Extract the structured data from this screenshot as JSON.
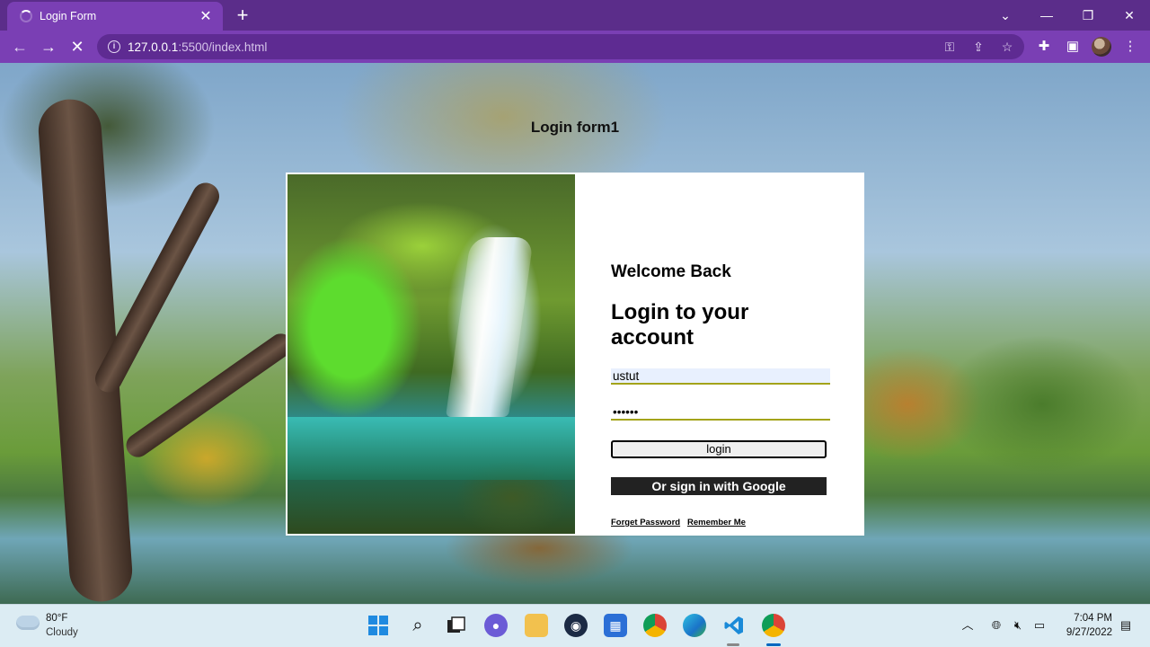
{
  "browser": {
    "tab_title": "Login Form",
    "tab_close": "✕",
    "new_tab": "+",
    "url_host": "127.0.0.1",
    "url_path": ":5500/index.html",
    "window_controls": {
      "tabsearch": "⌄",
      "minimize": "—",
      "restore": "❐",
      "close": "✕"
    },
    "icons": [
      "back-icon",
      "forward-icon",
      "stop-icon",
      "site-info-icon",
      "password-key-icon",
      "share-icon",
      "bookmark-star-icon",
      "extensions-icon",
      "side-panel-icon",
      "profile-avatar",
      "menu-icon"
    ]
  },
  "page": {
    "heading": "Login form1",
    "card": {
      "welcome": "Welcome Back",
      "title": "Login to your account",
      "username_value": "ustut",
      "password_value": "••••••",
      "login_label": "login",
      "google_label": "Or sign in with Google",
      "forget_password": "Forget Password",
      "remember_me": "Remember Me"
    }
  },
  "taskbar": {
    "weather_temp": "80°F",
    "weather_desc": "Cloudy",
    "apps": [
      "start",
      "search",
      "task-view",
      "chat",
      "file-explorer",
      "steam",
      "store",
      "chrome",
      "edge",
      "vscode",
      "chrome-profile"
    ],
    "time": "7:04 PM",
    "date": "9/27/2022"
  }
}
